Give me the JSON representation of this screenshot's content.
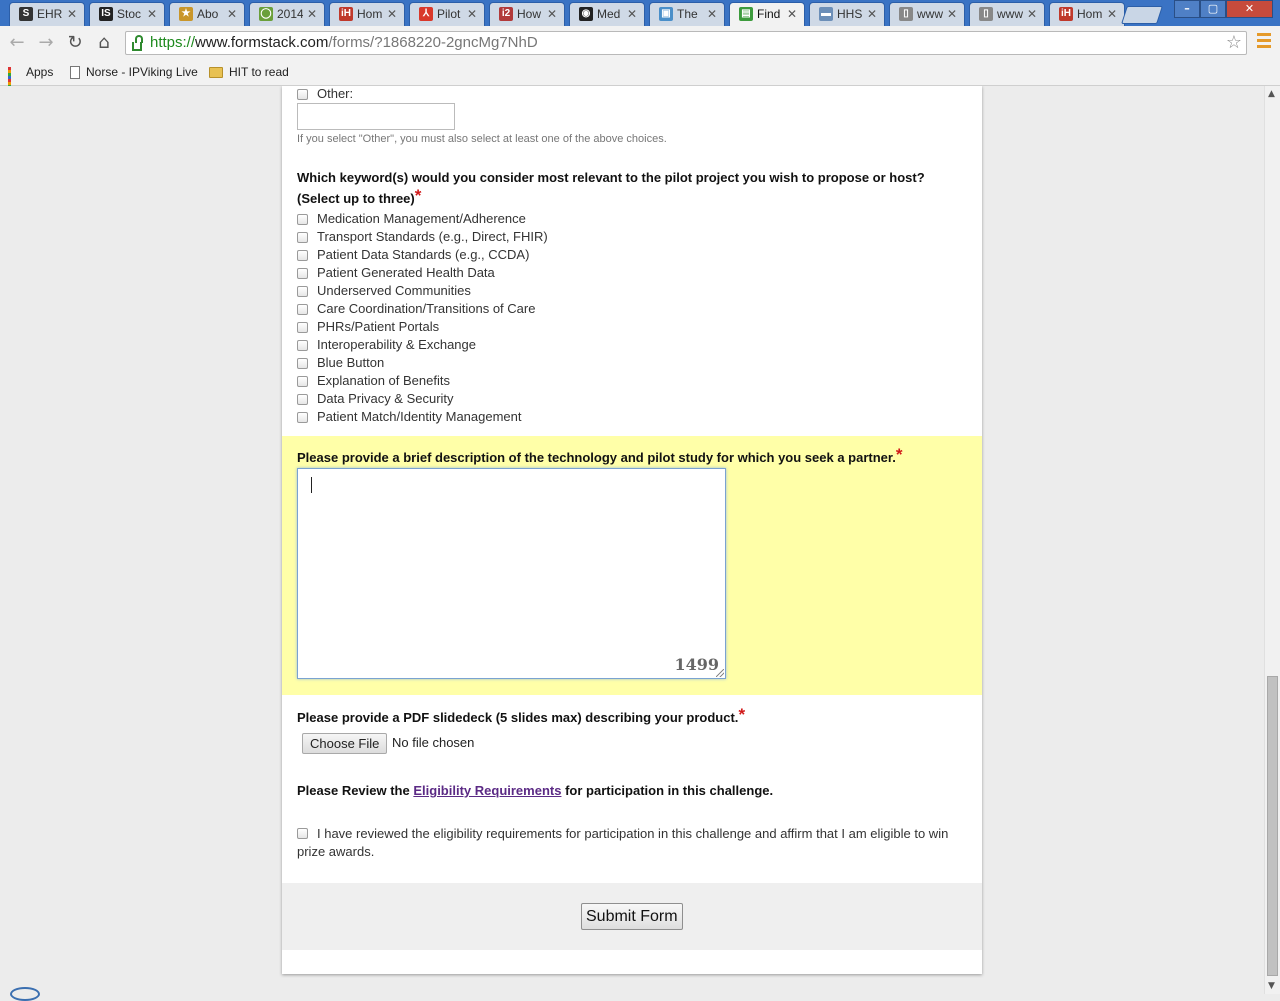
{
  "browser": {
    "tabs": [
      {
        "title": "EHR",
        "icon_text": "S",
        "icon_color": "#333333"
      },
      {
        "title": "Stoc",
        "icon_text": "IS",
        "icon_color": "#222222"
      },
      {
        "title": "Abo",
        "icon_text": "★",
        "icon_color": "#c9962a"
      },
      {
        "title": "2014",
        "icon_text": "◯",
        "icon_color": "#6a9f3a"
      },
      {
        "title": "Hom",
        "icon_text": "iH",
        "icon_color": "#c0392b"
      },
      {
        "title": "Pilot",
        "icon_text": "⅄",
        "icon_color": "#d9382a"
      },
      {
        "title": "How",
        "icon_text": "i2",
        "icon_color": "#b23a3a"
      },
      {
        "title": "Med",
        "icon_text": "◉",
        "icon_color": "#222222"
      },
      {
        "title": "The",
        "icon_text": "▣",
        "icon_color": "#4a8fc9"
      },
      {
        "title": "Find",
        "icon_text": "▤",
        "icon_color": "#3d9b3d"
      },
      {
        "title": "HHS",
        "icon_text": "▬",
        "icon_color": "#6c8fb8"
      },
      {
        "title": "www",
        "icon_text": "▯",
        "icon_color": "#888888"
      },
      {
        "title": "www",
        "icon_text": "▯",
        "icon_color": "#888888"
      },
      {
        "title": "Hom",
        "icon_text": "iH",
        "icon_color": "#c0392b"
      }
    ],
    "active_tab_index": 9,
    "url_scheme": "https://",
    "url_host": "www.formstack.com",
    "url_path": "/forms/?1868220-2gncMg7NhD",
    "bookmarks": {
      "apps": "Apps",
      "norse": "Norse - IPViking Live",
      "hit": "HIT to read"
    }
  },
  "form": {
    "other_label": "Other:",
    "other_value": "",
    "other_hint": "If you select \"Other\", you must also select at least one of the above choices.",
    "keywords_question": "Which keyword(s) would you consider most relevant to the pilot project you wish to propose or host? (Select up to three)",
    "keywords": [
      "Medication Management/Adherence",
      "Transport Standards (e.g., Direct, FHIR)",
      "Patient Data Standards (e.g., CCDA)",
      "Patient Generated Health Data",
      "Underserved Communities",
      "Care Coordination/Transitions of Care",
      "PHRs/Patient Portals",
      "Interoperability & Exchange",
      "Blue Button",
      "Explanation of Benefits",
      "Data Privacy & Security",
      "Patient Match/Identity Management"
    ],
    "description_question": "Please provide a brief description of the technology and pilot study for which you seek a partner.",
    "description_value": "",
    "char_counter": "1499",
    "pdf_question": "Please provide a PDF slidedeck (5 slides max) describing your product.",
    "choose_file_label": "Choose File",
    "no_file_text": "No file chosen",
    "review_prefix": "Please Review the",
    "review_link": "Eligibility Requirements",
    "review_suffix": "for participation in this challenge.",
    "affirm_text": "I have reviewed the eligibility requirements for participation in this challenge and affirm that I am eligible to win prize awards.",
    "submit_label": "Submit Form",
    "required_marker": "*"
  },
  "colors": {
    "highlight": "#ffffa8",
    "required": "#d01818",
    "link": "#5b2a85"
  }
}
